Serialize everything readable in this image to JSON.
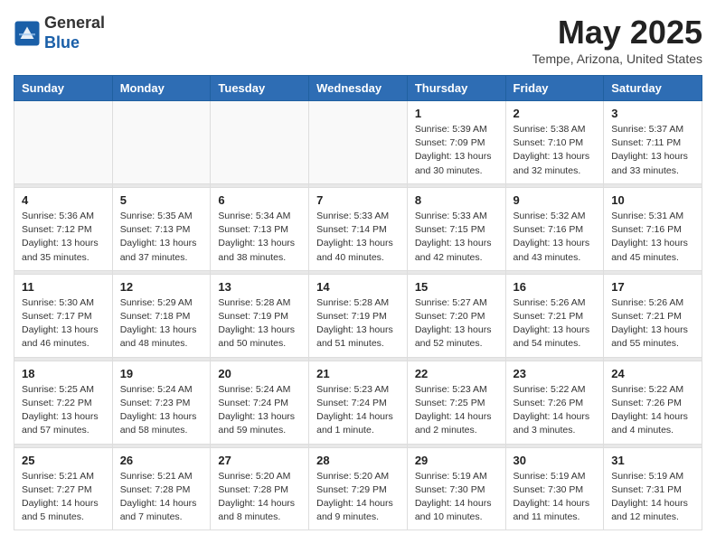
{
  "header": {
    "logo_line1": "General",
    "logo_line2": "Blue",
    "main_title": "May 2025",
    "subtitle": "Tempe, Arizona, United States"
  },
  "weekdays": [
    "Sunday",
    "Monday",
    "Tuesday",
    "Wednesday",
    "Thursday",
    "Friday",
    "Saturday"
  ],
  "weeks": [
    [
      {
        "day": "",
        "info": ""
      },
      {
        "day": "",
        "info": ""
      },
      {
        "day": "",
        "info": ""
      },
      {
        "day": "",
        "info": ""
      },
      {
        "day": "1",
        "info": "Sunrise: 5:39 AM\nSunset: 7:09 PM\nDaylight: 13 hours\nand 30 minutes."
      },
      {
        "day": "2",
        "info": "Sunrise: 5:38 AM\nSunset: 7:10 PM\nDaylight: 13 hours\nand 32 minutes."
      },
      {
        "day": "3",
        "info": "Sunrise: 5:37 AM\nSunset: 7:11 PM\nDaylight: 13 hours\nand 33 minutes."
      }
    ],
    [
      {
        "day": "4",
        "info": "Sunrise: 5:36 AM\nSunset: 7:12 PM\nDaylight: 13 hours\nand 35 minutes."
      },
      {
        "day": "5",
        "info": "Sunrise: 5:35 AM\nSunset: 7:13 PM\nDaylight: 13 hours\nand 37 minutes."
      },
      {
        "day": "6",
        "info": "Sunrise: 5:34 AM\nSunset: 7:13 PM\nDaylight: 13 hours\nand 38 minutes."
      },
      {
        "day": "7",
        "info": "Sunrise: 5:33 AM\nSunset: 7:14 PM\nDaylight: 13 hours\nand 40 minutes."
      },
      {
        "day": "8",
        "info": "Sunrise: 5:33 AM\nSunset: 7:15 PM\nDaylight: 13 hours\nand 42 minutes."
      },
      {
        "day": "9",
        "info": "Sunrise: 5:32 AM\nSunset: 7:16 PM\nDaylight: 13 hours\nand 43 minutes."
      },
      {
        "day": "10",
        "info": "Sunrise: 5:31 AM\nSunset: 7:16 PM\nDaylight: 13 hours\nand 45 minutes."
      }
    ],
    [
      {
        "day": "11",
        "info": "Sunrise: 5:30 AM\nSunset: 7:17 PM\nDaylight: 13 hours\nand 46 minutes."
      },
      {
        "day": "12",
        "info": "Sunrise: 5:29 AM\nSunset: 7:18 PM\nDaylight: 13 hours\nand 48 minutes."
      },
      {
        "day": "13",
        "info": "Sunrise: 5:28 AM\nSunset: 7:19 PM\nDaylight: 13 hours\nand 50 minutes."
      },
      {
        "day": "14",
        "info": "Sunrise: 5:28 AM\nSunset: 7:19 PM\nDaylight: 13 hours\nand 51 minutes."
      },
      {
        "day": "15",
        "info": "Sunrise: 5:27 AM\nSunset: 7:20 PM\nDaylight: 13 hours\nand 52 minutes."
      },
      {
        "day": "16",
        "info": "Sunrise: 5:26 AM\nSunset: 7:21 PM\nDaylight: 13 hours\nand 54 minutes."
      },
      {
        "day": "17",
        "info": "Sunrise: 5:26 AM\nSunset: 7:21 PM\nDaylight: 13 hours\nand 55 minutes."
      }
    ],
    [
      {
        "day": "18",
        "info": "Sunrise: 5:25 AM\nSunset: 7:22 PM\nDaylight: 13 hours\nand 57 minutes."
      },
      {
        "day": "19",
        "info": "Sunrise: 5:24 AM\nSunset: 7:23 PM\nDaylight: 13 hours\nand 58 minutes."
      },
      {
        "day": "20",
        "info": "Sunrise: 5:24 AM\nSunset: 7:24 PM\nDaylight: 13 hours\nand 59 minutes."
      },
      {
        "day": "21",
        "info": "Sunrise: 5:23 AM\nSunset: 7:24 PM\nDaylight: 14 hours\nand 1 minute."
      },
      {
        "day": "22",
        "info": "Sunrise: 5:23 AM\nSunset: 7:25 PM\nDaylight: 14 hours\nand 2 minutes."
      },
      {
        "day": "23",
        "info": "Sunrise: 5:22 AM\nSunset: 7:26 PM\nDaylight: 14 hours\nand 3 minutes."
      },
      {
        "day": "24",
        "info": "Sunrise: 5:22 AM\nSunset: 7:26 PM\nDaylight: 14 hours\nand 4 minutes."
      }
    ],
    [
      {
        "day": "25",
        "info": "Sunrise: 5:21 AM\nSunset: 7:27 PM\nDaylight: 14 hours\nand 5 minutes."
      },
      {
        "day": "26",
        "info": "Sunrise: 5:21 AM\nSunset: 7:28 PM\nDaylight: 14 hours\nand 7 minutes."
      },
      {
        "day": "27",
        "info": "Sunrise: 5:20 AM\nSunset: 7:28 PM\nDaylight: 14 hours\nand 8 minutes."
      },
      {
        "day": "28",
        "info": "Sunrise: 5:20 AM\nSunset: 7:29 PM\nDaylight: 14 hours\nand 9 minutes."
      },
      {
        "day": "29",
        "info": "Sunrise: 5:19 AM\nSunset: 7:30 PM\nDaylight: 14 hours\nand 10 minutes."
      },
      {
        "day": "30",
        "info": "Sunrise: 5:19 AM\nSunset: 7:30 PM\nDaylight: 14 hours\nand 11 minutes."
      },
      {
        "day": "31",
        "info": "Sunrise: 5:19 AM\nSunset: 7:31 PM\nDaylight: 14 hours\nand 12 minutes."
      }
    ]
  ]
}
